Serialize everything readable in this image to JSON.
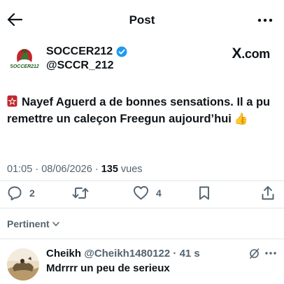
{
  "header": {
    "title": "Post",
    "back_icon": "arrow-left-icon",
    "more_icon": "more-dots-icon"
  },
  "author": {
    "name": "SOCCER212",
    "handle": "@SCCR_212",
    "verified": true,
    "avatar_text": "SOCCER212",
    "source_label": ".com",
    "source_mark": "X"
  },
  "post": {
    "text": "Nayef Aguerd a de bonnes sensations. Il a pu remettre un caleçon Freegun aujourd’hui",
    "leading_icon": "morocco-flag-icon",
    "trailing_emoji": "👍",
    "time": "01:05",
    "separator": "·",
    "date": "08/06/2026",
    "views": "135",
    "views_label": "vues"
  },
  "actions": {
    "replies": "2",
    "reposts": "",
    "likes": "4",
    "reply_icon": "reply-icon",
    "repost_icon": "repost-icon",
    "like_icon": "heart-icon",
    "bookmark_icon": "bookmark-icon",
    "share_icon": "share-icon"
  },
  "filter": {
    "label": "Pertinent"
  },
  "reply": {
    "name": "Cheikh",
    "handle": "@Cheikh1480122",
    "separator": "·",
    "time": "41 s",
    "text": "Mdrrrr un peu de serieux"
  },
  "colors": {
    "text": "#0f1419",
    "muted": "#536471",
    "verified": "#1d9bf0",
    "flag_red": "#c1272d",
    "divider": "#e3e7ea"
  }
}
